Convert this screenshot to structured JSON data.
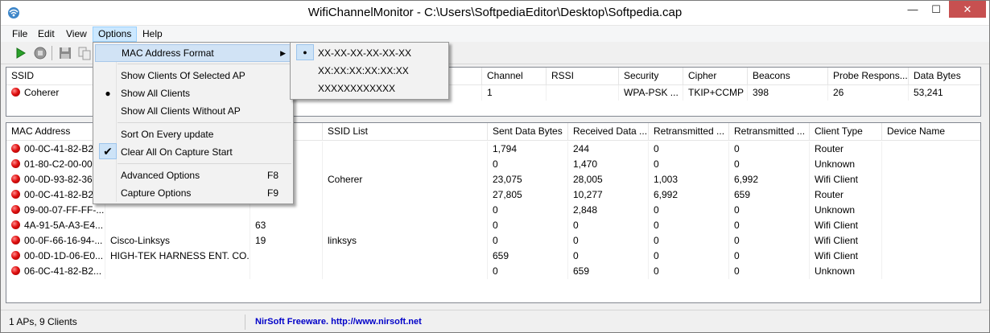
{
  "window": {
    "title": "WifiChannelMonitor  -  C:\\Users\\SoftpediaEditor\\Desktop\\Softpedia.cap",
    "minimize": "—",
    "maximize": "☐",
    "close": "✕"
  },
  "menubar": {
    "items": [
      "File",
      "Edit",
      "View",
      "Options",
      "Help"
    ]
  },
  "toolbar": {
    "icons": [
      "play-icon",
      "stop-icon",
      "save-icon",
      "copy-icon",
      "properties-icon"
    ]
  },
  "ap_list": {
    "columns": [
      "SSID",
      "",
      "",
      "",
      "",
      "Channel",
      "RSSI",
      "Security",
      "Cipher",
      "Beacons",
      "Probe Respons...",
      "Data Bytes"
    ],
    "rows": [
      [
        "Coherer",
        "",
        "",
        "",
        "",
        "1",
        "",
        "WPA-PSK ...",
        "TKIP+CCMP",
        "398",
        "26",
        "53,241"
      ]
    ]
  },
  "client_list": {
    "columns": [
      "MAC Address",
      "",
      "",
      "SSID List",
      "Sent Data Bytes",
      "Received Data ...",
      "Retransmitted ...",
      "Retransmitted ...",
      "Client Type",
      "Device Name"
    ],
    "rows": [
      [
        "00-0C-41-82-B2",
        "",
        "",
        "",
        "1,794",
        "244",
        "0",
        "0",
        "Router",
        ""
      ],
      [
        "01-80-C2-00-00",
        "",
        "",
        "",
        "0",
        "1,470",
        "0",
        "0",
        "Unknown",
        ""
      ],
      [
        "00-0D-93-82-36",
        "",
        "",
        "Coherer",
        "23,075",
        "28,005",
        "1,003",
        "6,992",
        "Wifi Client",
        ""
      ],
      [
        "00-0C-41-82-B2",
        "",
        "",
        "",
        "27,805",
        "10,277",
        "6,992",
        "659",
        "Router",
        ""
      ],
      [
        "09-00-07-FF-FF-...",
        "",
        "",
        "",
        "0",
        "2,848",
        "0",
        "0",
        "Unknown",
        ""
      ],
      [
        "4A-91-5A-A3-E4...",
        "",
        "63",
        "",
        "0",
        "0",
        "0",
        "0",
        "Wifi Client",
        ""
      ],
      [
        "00-0F-66-16-94-...",
        "Cisco-Linksys",
        "19",
        "linksys",
        "0",
        "0",
        "0",
        "0",
        "Wifi Client",
        ""
      ],
      [
        "00-0D-1D-06-E0...",
        "HIGH-TEK HARNESS ENT. CO....",
        "",
        "",
        "659",
        "0",
        "0",
        "0",
        "Wifi Client",
        ""
      ],
      [
        "06-0C-41-82-B2...",
        "",
        "",
        "",
        "0",
        "659",
        "0",
        "0",
        "Unknown",
        ""
      ]
    ]
  },
  "options_menu": {
    "items": [
      {
        "label": "MAC Address Format",
        "shortcut": "",
        "submenu": true,
        "mark": ""
      },
      {
        "label": "Show Clients Of Selected AP",
        "shortcut": "",
        "submenu": false,
        "mark": ""
      },
      {
        "label": "Show All Clients",
        "shortcut": "",
        "submenu": false,
        "mark": "●"
      },
      {
        "label": "Show All Clients Without AP",
        "shortcut": "",
        "submenu": false,
        "mark": ""
      },
      {
        "label": "Sort On Every update",
        "shortcut": "",
        "submenu": false,
        "mark": ""
      },
      {
        "label": "Clear All On Capture Start",
        "shortcut": "",
        "submenu": false,
        "mark": "✔"
      },
      {
        "label": "Advanced Options",
        "shortcut": "F8",
        "submenu": false,
        "mark": ""
      },
      {
        "label": "Capture Options",
        "shortcut": "F9",
        "submenu": false,
        "mark": ""
      }
    ]
  },
  "mac_menu": {
    "items": [
      {
        "label": "XX-XX-XX-XX-XX-XX",
        "mark": "●"
      },
      {
        "label": "XX:XX:XX:XX:XX:XX",
        "mark": ""
      },
      {
        "label": "XXXXXXXXXXXX",
        "mark": ""
      }
    ]
  },
  "status": {
    "counts": "1 APs, 9 Clients",
    "link": "NirSoft Freeware.  http://www.nirsoft.net"
  },
  "colors": {
    "menu_highlight": "#d1e3f5",
    "status_link": "#0000c8",
    "close_button": "#c75050"
  }
}
